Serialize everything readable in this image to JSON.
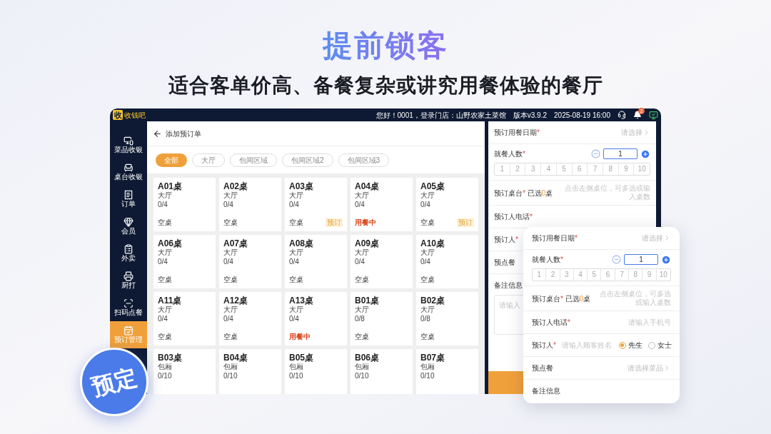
{
  "hero": {
    "title": "提前锁客",
    "subtitle": "适合客单价高、备餐复杂或讲究用餐体验的餐厅"
  },
  "top_bar": {
    "logo_mark": "收",
    "logo_text": "收钱吧",
    "greeting": "您好！0001，登录门店：山野农家土菜馆",
    "version": "版本v3.9.2",
    "datetime": "2025-08-19 16:00",
    "notification_count": "2"
  },
  "sidebar": {
    "items": [
      {
        "label": "菜品收银",
        "selected": false
      },
      {
        "label": "桌台收银",
        "selected": false
      },
      {
        "label": "订单",
        "selected": false
      },
      {
        "label": "会员",
        "selected": false
      },
      {
        "label": "外卖",
        "selected": false
      },
      {
        "label": "厨打",
        "selected": false
      },
      {
        "label": "扫码点餐",
        "selected": false
      },
      {
        "label": "预订管理",
        "selected": true
      }
    ]
  },
  "page": {
    "title": "添加预订单"
  },
  "area_filters": [
    {
      "label": "全部",
      "selected": true
    },
    {
      "label": "大厅",
      "selected": false
    },
    {
      "label": "包间区域",
      "selected": false
    },
    {
      "label": "包间区域2",
      "selected": false
    },
    {
      "label": "包间区域3",
      "selected": false
    }
  ],
  "tables": [
    {
      "name": "A01桌",
      "area": "大厅",
      "seats": "0/4",
      "status": "空桌",
      "busy": false
    },
    {
      "name": "A02桌",
      "area": "大厅",
      "seats": "0/4",
      "status": "空桌",
      "busy": false
    },
    {
      "name": "A03桌",
      "area": "大厅",
      "seats": "0/4",
      "status": "空桌",
      "busy": false,
      "tag": "预订"
    },
    {
      "name": "A04桌",
      "area": "大厅",
      "seats": "0/4",
      "status": "用餐中",
      "busy": true
    },
    {
      "name": "A05桌",
      "area": "大厅",
      "seats": "0/4",
      "status": "空桌",
      "busy": false,
      "tag": "预订"
    },
    {
      "name": "A06桌",
      "area": "大厅",
      "seats": "0/4",
      "status": "空桌",
      "busy": false
    },
    {
      "name": "A07桌",
      "area": "大厅",
      "seats": "0/4",
      "status": "空桌",
      "busy": false
    },
    {
      "name": "A08桌",
      "area": "大厅",
      "seats": "0/4",
      "status": "空桌",
      "busy": false
    },
    {
      "name": "A09桌",
      "area": "大厅",
      "seats": "0/4",
      "status": "空桌",
      "busy": false
    },
    {
      "name": "A10桌",
      "area": "大厅",
      "seats": "0/4",
      "status": "空桌",
      "busy": false
    },
    {
      "name": "A11桌",
      "area": "大厅",
      "seats": "0/4",
      "status": "空桌",
      "busy": false
    },
    {
      "name": "A12桌",
      "area": "大厅",
      "seats": "0/4",
      "status": "空桌",
      "busy": false
    },
    {
      "name": "A13桌",
      "area": "大厅",
      "seats": "0/4",
      "status": "用餐中",
      "busy": true
    },
    {
      "name": "B01桌",
      "area": "大厅",
      "seats": "0/8",
      "status": "空桌",
      "busy": false
    },
    {
      "name": "B02桌",
      "area": "大厅",
      "seats": "0/8",
      "status": "空桌",
      "busy": false
    },
    {
      "name": "B03桌",
      "area": "包厢",
      "seats": "0/10"
    },
    {
      "name": "B04桌",
      "area": "包厢",
      "seats": "0/10"
    },
    {
      "name": "B05桌",
      "area": "包厢",
      "seats": "0/10"
    },
    {
      "name": "B06桌",
      "area": "包厢",
      "seats": "0/10"
    },
    {
      "name": "B07桌",
      "area": "包厢",
      "seats": "0/10"
    }
  ],
  "back_form": {
    "fields": [
      {
        "kind": "select",
        "label": "预订用餐日期",
        "mark": "*",
        "placeholder": "请选择"
      },
      {
        "kind": "stepper",
        "label": "就餐人数",
        "mark": "*",
        "value": "1",
        "options": [
          "1",
          "2",
          "3",
          "4",
          "5",
          "6",
          "7",
          "8",
          "9",
          "10"
        ]
      },
      {
        "kind": "tables",
        "label": "预订桌台",
        "mark": "*",
        "selected_text": "已选",
        "count": "0",
        "unit": "桌",
        "hint": "点击左侧桌位，可多选或输入桌数"
      },
      {
        "kind": "input",
        "label": "预订人电话",
        "mark": "*"
      },
      {
        "kind": "input",
        "label": "预订人",
        "mark": "*"
      },
      {
        "kind": "select",
        "label": "预点餐"
      },
      {
        "kind": "textarea",
        "label": "备注信息",
        "placeholder": "请输入"
      }
    ]
  },
  "front_form": {
    "fields": [
      {
        "kind": "select",
        "label": "预订用餐日期",
        "mark": "*",
        "placeholder": "请选择"
      },
      {
        "kind": "stepper",
        "label": "就餐人数",
        "mark": "*",
        "value": "1",
        "options": [
          "1",
          "2",
          "3",
          "4",
          "5",
          "6",
          "7",
          "8",
          "9",
          "10"
        ]
      },
      {
        "kind": "tables",
        "label": "预订桌台",
        "mark": "*",
        "selected_text": "已选",
        "count": "0",
        "unit": "桌",
        "hint": "点击左侧桌位，可多选或输入桌数"
      },
      {
        "kind": "input",
        "label": "预订人电话",
        "mark": "*",
        "placeholder": "请输入手机号"
      },
      {
        "kind": "person",
        "label": "预订人",
        "mark": "*",
        "placeholder": "请输入顾客姓名",
        "options": [
          {
            "label": "先生",
            "selected": true
          },
          {
            "label": "女士",
            "selected": false
          }
        ]
      },
      {
        "kind": "select",
        "label": "预点餐",
        "placeholder": "请选择菜品"
      },
      {
        "kind": "textarea",
        "label": "备注信息"
      }
    ]
  },
  "badge": "预定"
}
